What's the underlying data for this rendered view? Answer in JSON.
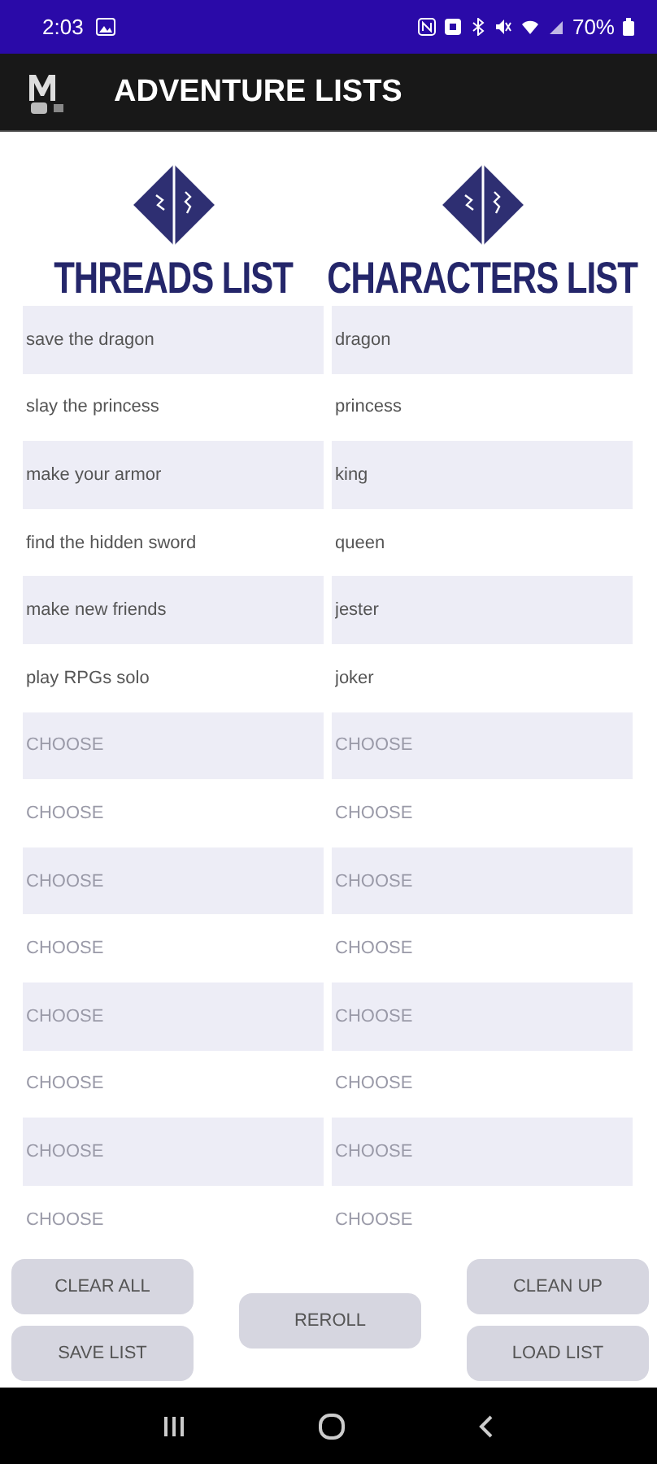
{
  "status_bar": {
    "time": "2:03",
    "battery": "70%"
  },
  "app_bar": {
    "title": "ADVENTURE LISTS"
  },
  "lists": [
    {
      "title": "THREADS LIST",
      "entries": [
        {
          "value": "save the dragon"
        },
        {
          "value": "slay the princess"
        },
        {
          "value": "make your armor"
        },
        {
          "value": "find the hidden sword"
        },
        {
          "value": "make new friends"
        },
        {
          "value": "play RPGs solo"
        },
        {
          "placeholder": "CHOOSE"
        },
        {
          "placeholder": "CHOOSE"
        },
        {
          "placeholder": "CHOOSE"
        },
        {
          "placeholder": "CHOOSE"
        },
        {
          "placeholder": "CHOOSE"
        },
        {
          "placeholder": "CHOOSE"
        },
        {
          "placeholder": "CHOOSE"
        },
        {
          "placeholder": "CHOOSE"
        }
      ]
    },
    {
      "title": "CHARACTERS LIST",
      "entries": [
        {
          "value": "dragon"
        },
        {
          "value": "princess"
        },
        {
          "value": "king"
        },
        {
          "value": "queen"
        },
        {
          "value": "jester"
        },
        {
          "value": "joker"
        },
        {
          "placeholder": "CHOOSE"
        },
        {
          "placeholder": "CHOOSE"
        },
        {
          "placeholder": "CHOOSE"
        },
        {
          "placeholder": "CHOOSE"
        },
        {
          "placeholder": "CHOOSE"
        },
        {
          "placeholder": "CHOOSE"
        },
        {
          "placeholder": "CHOOSE"
        },
        {
          "placeholder": "CHOOSE"
        }
      ]
    }
  ],
  "buttons": {
    "left": [
      "CLEAR ALL",
      "SAVE LIST"
    ],
    "center": [
      "REROLL"
    ],
    "right": [
      "CLEAN UP",
      "LOAD LIST"
    ]
  }
}
